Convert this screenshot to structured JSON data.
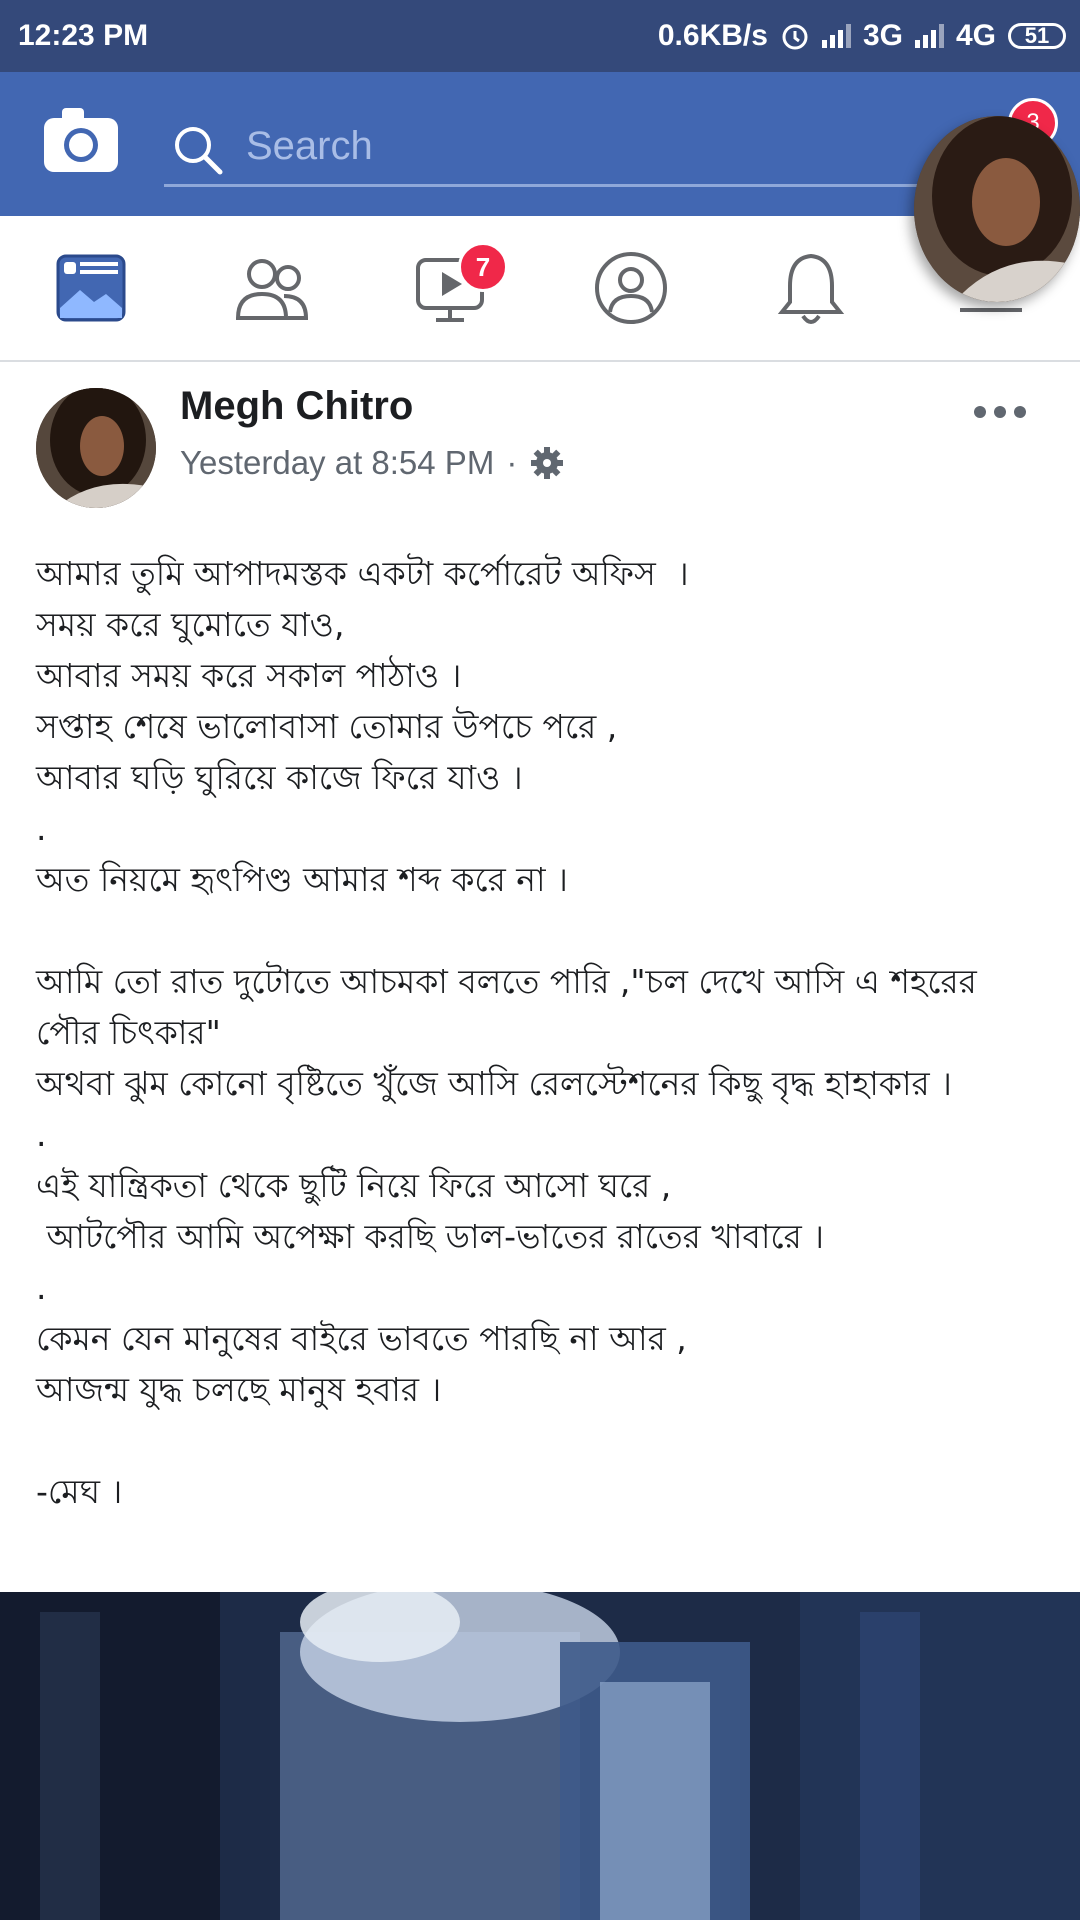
{
  "status_bar": {
    "time": "12:23 PM",
    "network_speed": "0.6KB/s",
    "net1": "3G",
    "net2": "4G",
    "battery": "51"
  },
  "header": {
    "search_placeholder": "Search",
    "chat_head_badge": "3",
    "brand_color": "#4267b2"
  },
  "nav": {
    "tabs": [
      "news-feed",
      "friends",
      "watch",
      "profile",
      "notifications",
      "menu"
    ],
    "watch_badge": "7"
  },
  "post": {
    "author": "Megh Chitro",
    "timestamp": "Yesterday at 8:54 PM",
    "separator": "·",
    "text": "আমার তুমি আপাদমস্তক একটা কর্পোরেট অফিস  ।\nসময় করে ঘুমোতে যাও,\nআবার সময় করে সকাল পাঠাও ।\nসপ্তাহ শেষে ভালোবাসা তোমার উপচে পরে ,\nআবার ঘড়ি ঘুরিয়ে কাজে ফিরে যাও ।\n.\nঅত নিয়মে হৃৎপিণ্ড আমার শব্দ করে না ।\n\nআমি তো রাত দুটোতে আচমকা বলতে পারি ,\"চল দেখে আসি এ শহরের পৌর চিৎকার\"\nঅথবা ঝুম কোনো বৃষ্টিতে খুঁজে আসি রেলস্টেশনের কিছু বৃদ্ধ হাহাকার ।\n.\nএই যান্ত্রিকতা থেকে ছুটি নিয়ে ফিরে আসো ঘরে ,\n আটপৌর আমি অপেক্ষা করছি ডাল-ভাতের রাতের খাবারে ।\n.\nকেমন যেন মানুষের বাইরে ভাবতে পারছি না আর ,\nআজন্ম যুদ্ধ চলছে মানুষ হবার ।\n\n-মেঘ ।"
  }
}
